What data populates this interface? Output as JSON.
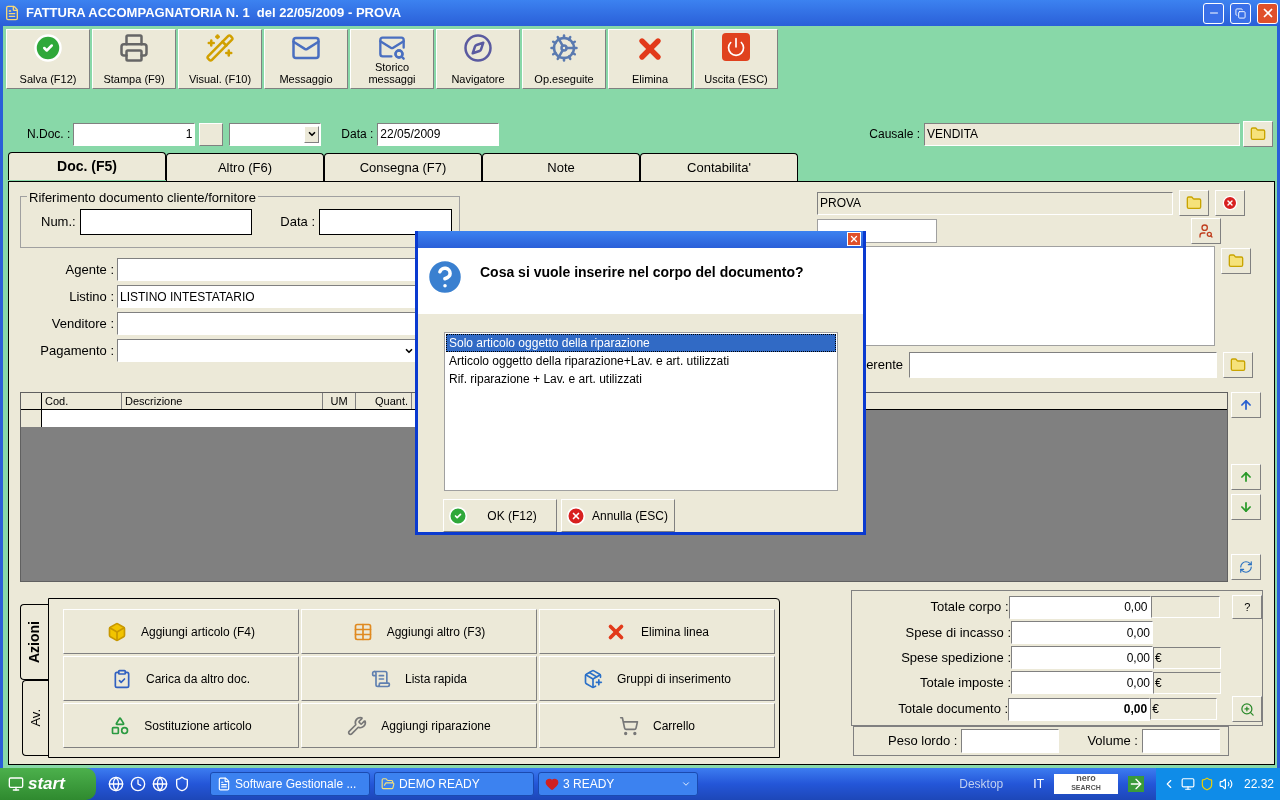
{
  "window": {
    "title": "FATTURA ACCOMPAGNATORIA N. 1  del 22/05/2009 - PROVA"
  },
  "toolbar": [
    {
      "label": "Salva (F12)"
    },
    {
      "label": "Stampa (F9)"
    },
    {
      "label": "Visual. (F10)"
    },
    {
      "label": "Messaggio"
    },
    {
      "label": "Storico messaggi"
    },
    {
      "label": "Navigatore"
    },
    {
      "label": "Op.eseguite"
    },
    {
      "label": "Elimina"
    },
    {
      "label": "Uscita (ESC)"
    }
  ],
  "header": {
    "ndoc_label": "N.Doc. :",
    "ndoc_value": "1",
    "data_label": "Data :",
    "data_value": "22/05/2009",
    "causale_label": "Causale :",
    "causale_value": "VENDITA"
  },
  "tabs": [
    {
      "label": "Doc. (F5)",
      "selected": true
    },
    {
      "label": "Altro (F6)",
      "selected": false
    },
    {
      "label": "Consegna (F7)",
      "selected": false
    },
    {
      "label": "Note",
      "selected": false
    },
    {
      "label": "Contabilita'",
      "selected": false
    }
  ],
  "riferimento": {
    "title": "Riferimento documento cliente/fornitore",
    "num_label": "Num.:",
    "data_label": "Data :"
  },
  "fields": [
    {
      "label": "Agente :",
      "kind": "text"
    },
    {
      "label": "Listino :",
      "value": "LISTINO INTESTATARIO",
      "kind": "text"
    },
    {
      "label": "Venditore :",
      "kind": "text"
    },
    {
      "label": "Pagamento :",
      "kind": "combo"
    }
  ],
  "customer": {
    "name": "PROVA",
    "referente_label": "erente"
  },
  "grid": {
    "columns": [
      "Cod.",
      "Descrizione",
      "UM",
      "Quant."
    ]
  },
  "dialog": {
    "question": "Cosa si vuole inserire nel corpo del documento?",
    "options": [
      {
        "label": "Solo articolo oggetto della riparazione",
        "selected": true
      },
      {
        "label": "Articolo oggetto della riparazione+Lav. e art. utilizzati",
        "selected": false
      },
      {
        "label": "Rif. riparazione + Lav. e art. utilizzati",
        "selected": false
      }
    ],
    "buttons": [
      "OK (F12)",
      "Annulla (ESC)"
    ]
  },
  "actions": {
    "side_tabs": [
      {
        "label": "Azioni",
        "selected": true
      },
      {
        "label": "Av.",
        "selected": false
      }
    ],
    "buttons": [
      "Aggiungi articolo (F4)",
      "Aggiungi altro (F3)",
      "Elimina linea",
      "Carica da altro doc.",
      "Lista rapida",
      "Gruppi di inserimento",
      "Sostituzione articolo",
      "Aggiungi riparazione",
      "Carrello"
    ]
  },
  "totals": [
    {
      "label": "Totale corpo :",
      "value": "0,00",
      "kind": "help",
      "help": "?",
      "bold": false
    },
    {
      "label": "Spese di incasso :",
      "value": "0,00",
      "kind": "plain",
      "bold": false
    },
    {
      "label": "Spese spedizione :",
      "value": "0,00",
      "kind": "currency",
      "currency": "€",
      "bold": false
    },
    {
      "label": "Totale imposte :",
      "value": "0,00",
      "kind": "currency",
      "currency": "€",
      "bold": false
    },
    {
      "label": "Totale documento :",
      "value": "0,00",
      "kind": "zoom",
      "currency": "€",
      "bold": true
    }
  ],
  "weights": {
    "peso_label": "Peso lordo :",
    "volume_label": "Volume :"
  },
  "taskbar": {
    "start": "start",
    "tasks": [
      "Software Gestionale ...",
      "DEMO READY",
      "3 READY"
    ],
    "desktop": "Desktop",
    "language": "IT",
    "search_logo": "nero",
    "search_logo_sub": "SEARCH",
    "clock": "22.32"
  }
}
